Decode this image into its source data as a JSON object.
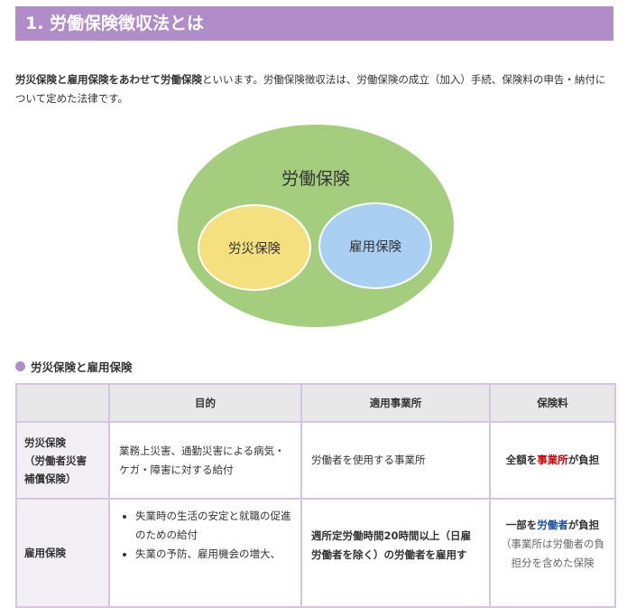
{
  "section_title": "1. 労働保険徴収法とは",
  "intro": {
    "term1": "労災保険",
    "conj1": "と",
    "term2": "雇用保険",
    "conj2": "をあわせて",
    "term3": "労働保険",
    "rest": "といいます。労働保険徴収法は、労働保険の成立（加入）手続、保険料の申告・納付について定めた法律です。"
  },
  "diagram": {
    "outer_label": "労働保険",
    "left_label": "労災保険",
    "right_label": "雇用保険",
    "colors": {
      "outer": "#a5cd7e",
      "left": "#f5e080",
      "right": "#a9cff2"
    }
  },
  "table_heading": "労災保険と雇用保険",
  "table": {
    "headers": [
      "",
      "目的",
      "適用事業所",
      "保険料"
    ],
    "rows": [
      {
        "name_line1": "労災保険",
        "name_line2": "（労働者災害",
        "name_line3": "補償保険）",
        "purpose": "業務上災害、通勤災害による病気・ケガ・障害に対する給付",
        "scope": "労働者を使用する事業所",
        "premium_pre": "全額を",
        "premium_highlight": "事業所",
        "premium_post": "が負担"
      },
      {
        "name": "雇用保険",
        "purpose_item1": "失業時の生活の安定と就職の促進のための給付",
        "purpose_item2": "失業の予防、雇用機会の増大、",
        "scope": "週所定労働時間20時間以上（日雇労働者を除く）の労働者を雇用す",
        "premium_pre": "一部を",
        "premium_highlight": "労働者",
        "premium_post": "が負担",
        "premium_note": "（事業所は労働者の負担分を含めた保険"
      }
    ]
  }
}
